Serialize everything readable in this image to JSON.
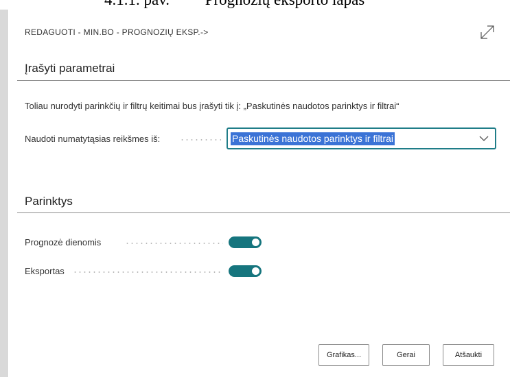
{
  "document_caption": "4.1.1. pav.         Prognozių eksporto lapas",
  "dialog": {
    "title": "REDAGUOTI - MIN.BO - PROGNOZIŲ EKSP.->",
    "saved_params": {
      "heading": "Įrašyti parametrai",
      "info": "Toliau nurodyti parinkčių ir filtrų keitimai bus įrašyti tik į: „Paskutinės naudotos parinktys ir filtrai“",
      "defaults_label": "Naudoti numatytąsias reikšmes iš:",
      "defaults_value": "Paskutinės naudotos parinktys ir filtrai"
    },
    "options": {
      "heading": "Parinktys",
      "forecast_by_days": {
        "label": "Prognozė dienomis",
        "value": "on"
      },
      "export": {
        "label": "Eksportas",
        "value": "on"
      }
    },
    "buttons": {
      "chart": "Grafikas...",
      "ok": "Gerai",
      "cancel": "Atšaukti"
    }
  },
  "colors": {
    "accent": "#16757e",
    "selection": "#3b73d6"
  },
  "icons": {
    "expand": "expand-diagonal-arrow-icon",
    "dropdown": "chevron-down-icon"
  }
}
